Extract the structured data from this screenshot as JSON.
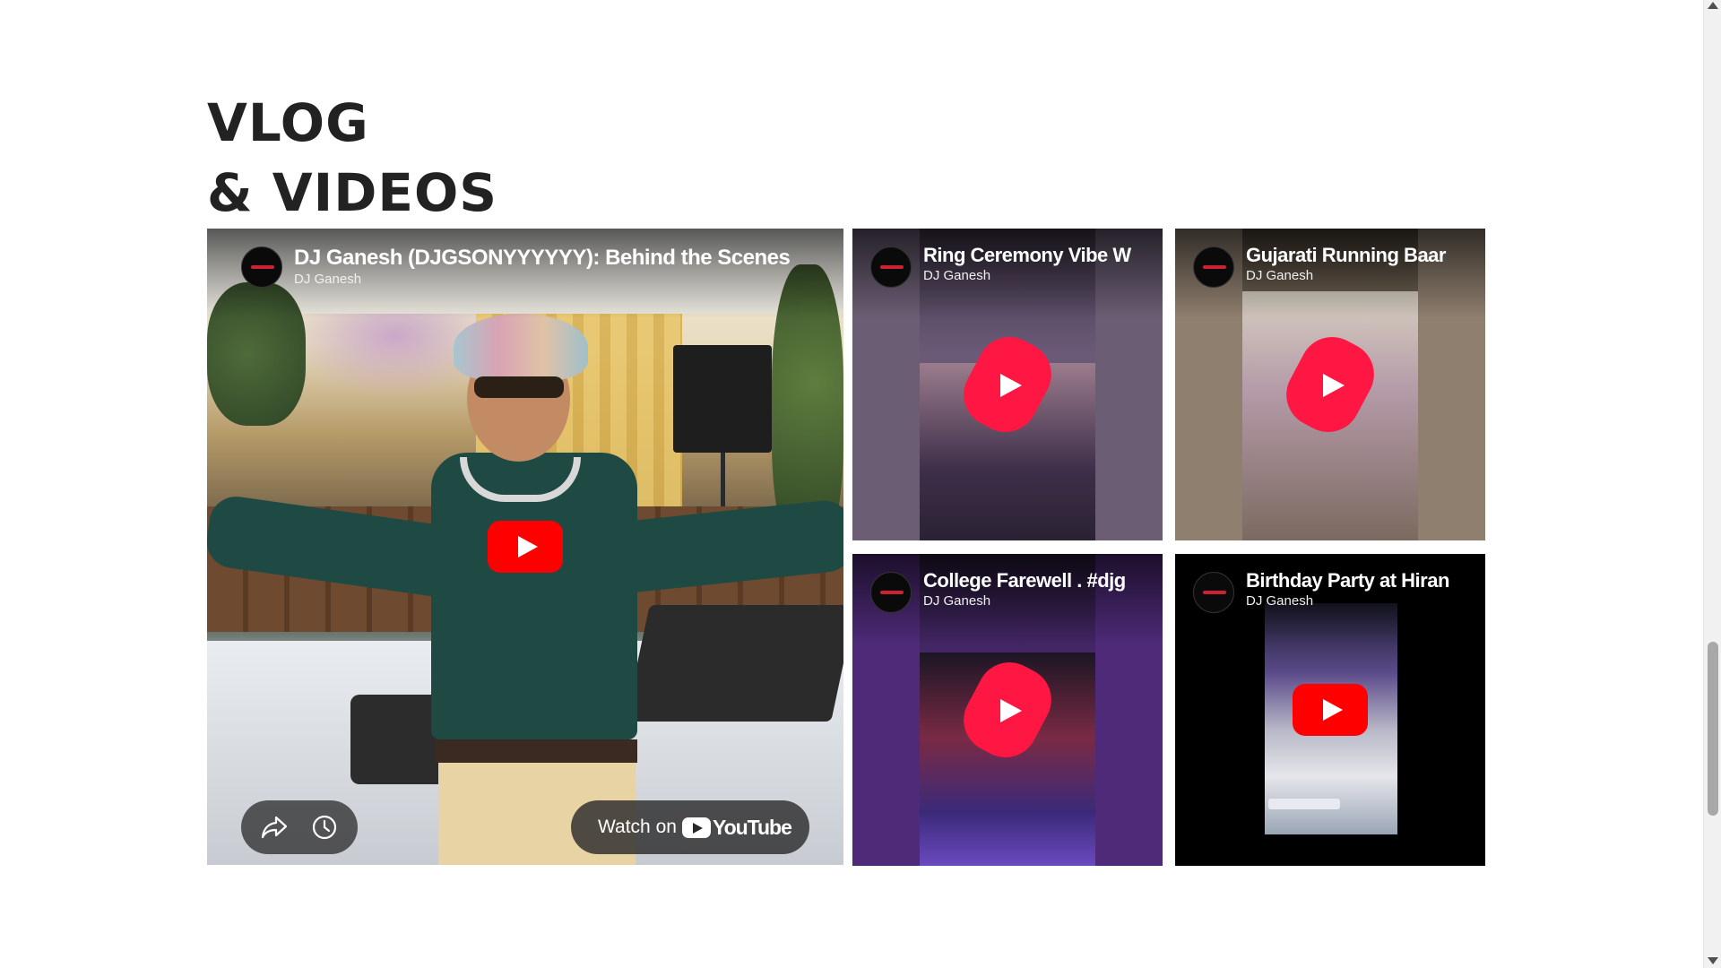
{
  "section": {
    "heading_line1": "VLOG",
    "heading_line2": "& VIDEOS"
  },
  "videos": [
    {
      "title": "DJ Ganesh (DJGSONYYYYYY): Behind the Scenes",
      "author": "DJ Ganesh",
      "type": "video",
      "watch_label": "Watch on",
      "watch_brand": "YouTube"
    },
    {
      "title": "Ring Ceremony Vibe W",
      "author": "DJ Ganesh",
      "type": "short"
    },
    {
      "title": "Gujarati Running Baar",
      "author": "DJ Ganesh",
      "type": "short"
    },
    {
      "title": "College Farewell . #djg",
      "author": "DJ Ganesh",
      "type": "short"
    },
    {
      "title": "Birthday Party at Hiran",
      "author": "DJ Ganesh",
      "type": "video"
    }
  ],
  "icons": {
    "share": "share-icon",
    "watch_later": "clock-icon",
    "play": "play-icon",
    "youtube": "youtube-logo-icon"
  },
  "colors": {
    "heading": "#222222",
    "youtube_red": "#ff0000",
    "shorts_red": "#ff1744"
  }
}
